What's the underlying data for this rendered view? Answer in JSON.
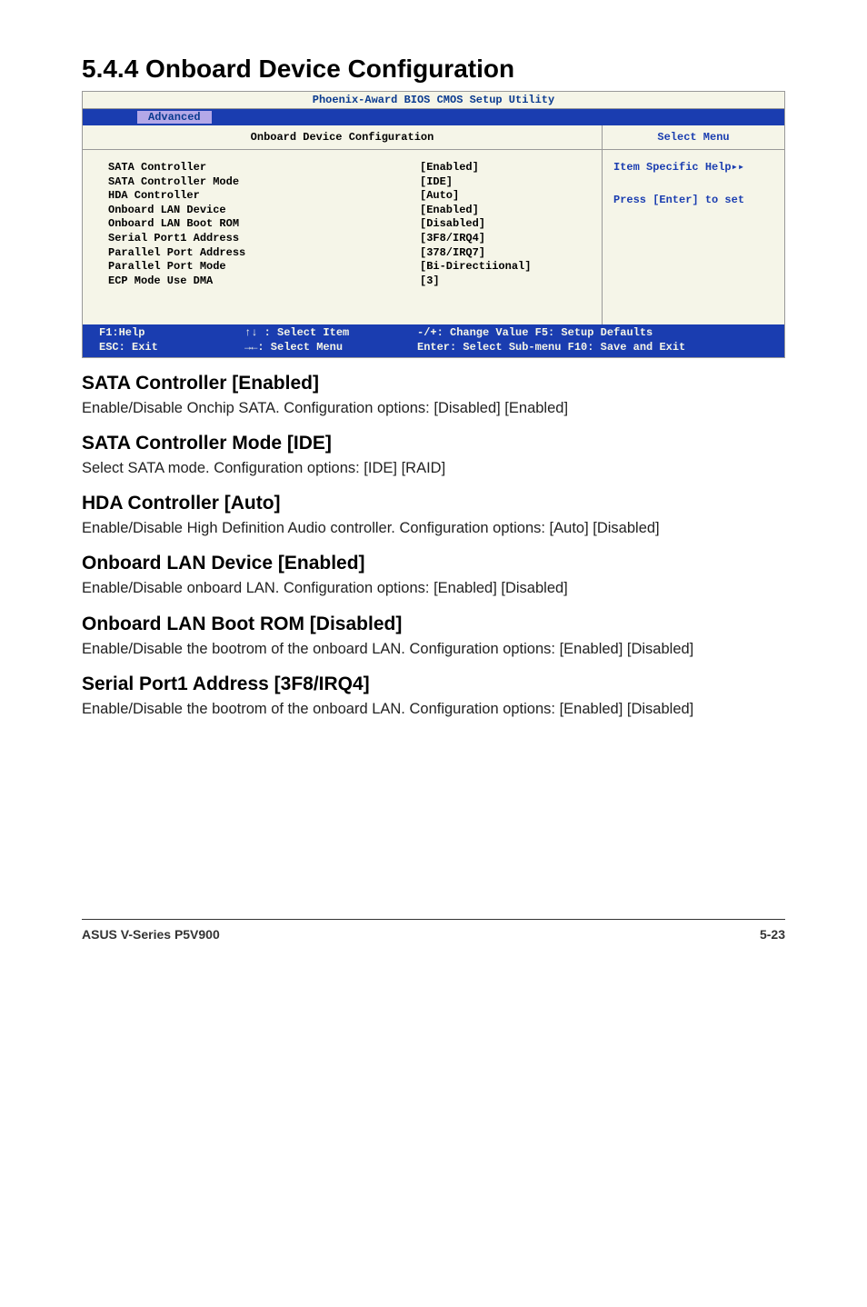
{
  "heading": "5.4.4   Onboard Device Configuration",
  "bios": {
    "title": "Phoenix-Award BIOS CMOS Setup Utility",
    "tab": "Advanced",
    "subtitle": "Onboard Device Configuration",
    "rows": [
      {
        "label": "SATA Controller",
        "value": "[Enabled]"
      },
      {
        "label": "SATA Controller Mode",
        "value": "[IDE]"
      },
      {
        "label": "HDA Controller",
        "value": "[Auto]"
      },
      {
        "label": "Onboard LAN Device",
        "value": "[Enabled]"
      },
      {
        "label": "Onboard LAN Boot ROM",
        "value": "[Disabled]"
      },
      {
        "label": "Serial Port1 Address",
        "value": "[3F8/IRQ4]"
      },
      {
        "label": "Parallel Port Address",
        "value": "[378/IRQ7]"
      },
      {
        "label": "Parallel Port Mode",
        "value": "[Bi-Directiional]"
      },
      {
        "label": "ECP Mode Use DMA",
        "value": "[3]"
      }
    ],
    "helpTitle": "Select Menu",
    "helpLine1": "Item Specific Help▸▸",
    "helpLine2": "Press [Enter] to set",
    "footer": {
      "c1a": "F1:Help",
      "c1b": "ESC: Exit",
      "c2a": "↑↓ : Select Item",
      "c2b": "→←: Select Menu",
      "c3a": "-/+: Change Value     F5: Setup Defaults",
      "c3b": "Enter: Select Sub-menu  F10: Save and Exit"
    }
  },
  "sections": [
    {
      "h": "SATA Controller [Enabled]",
      "p": "Enable/Disable Onchip SATA. Configuration options: [Disabled] [Enabled]"
    },
    {
      "h": "SATA Controller Mode [IDE]",
      "p": "Select SATA mode. Configuration options: [IDE] [RAID]"
    },
    {
      "h": "HDA Controller [Auto]",
      "p": "Enable/Disable High Definition Audio controller. Configuration options: [Auto] [Disabled]"
    },
    {
      "h": "Onboard LAN Device [Enabled]",
      "p": "Enable/Disable onboard LAN. Configuration options: [Enabled] [Disabled]"
    },
    {
      "h": "Onboard LAN Boot ROM [Disabled]",
      "p": "Enable/Disable the bootrom of the onboard LAN. Configuration options: [Enabled] [Disabled]"
    },
    {
      "h": "Serial Port1 Address [3F8/IRQ4]",
      "p": "Enable/Disable the bootrom of the onboard LAN. Configuration options: [Enabled] [Disabled]"
    }
  ],
  "footerLeft": "ASUS V-Series P5V900",
  "footerRight": "5-23"
}
